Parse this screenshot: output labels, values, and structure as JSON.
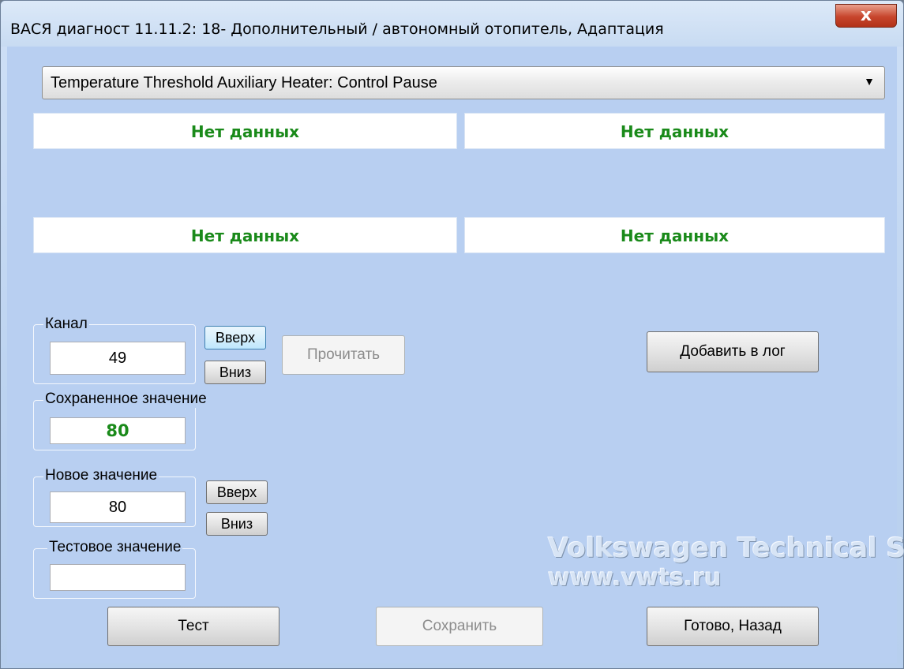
{
  "window": {
    "title": "ВАСЯ диагност 11.11.2: 18- Дополнительный / автономный отопитель, Адаптация",
    "close_glyph": "x"
  },
  "combo": {
    "value": "Temperature Threshold Auxiliary Heater: Control Pause",
    "arrow_glyph": "▼"
  },
  "data_boxes": [
    "Нет данных",
    "Нет данных",
    "Нет данных",
    "Нет данных"
  ],
  "channel": {
    "label": "Канал",
    "value": "49",
    "up_label": "Вверх",
    "down_label": "Вниз",
    "read_label": "Прочитать"
  },
  "log_button_label": "Добавить в лог",
  "saved_value": {
    "label": "Сохраненное значение",
    "value": "80"
  },
  "new_value": {
    "label": "Новое значение",
    "value": "80",
    "up_label": "Вверх",
    "down_label": "Вниз"
  },
  "test_value": {
    "label": "Тестовое значение",
    "value": ""
  },
  "bottom_buttons": {
    "test": "Тест",
    "save": "Сохранить",
    "done": "Готово, Назад"
  },
  "watermark": {
    "line1": "Volkswagen Technical Site",
    "line2": "www.vwts.ru"
  },
  "colors": {
    "data_text": "#1a8a1a",
    "background": "#b8cff1"
  }
}
